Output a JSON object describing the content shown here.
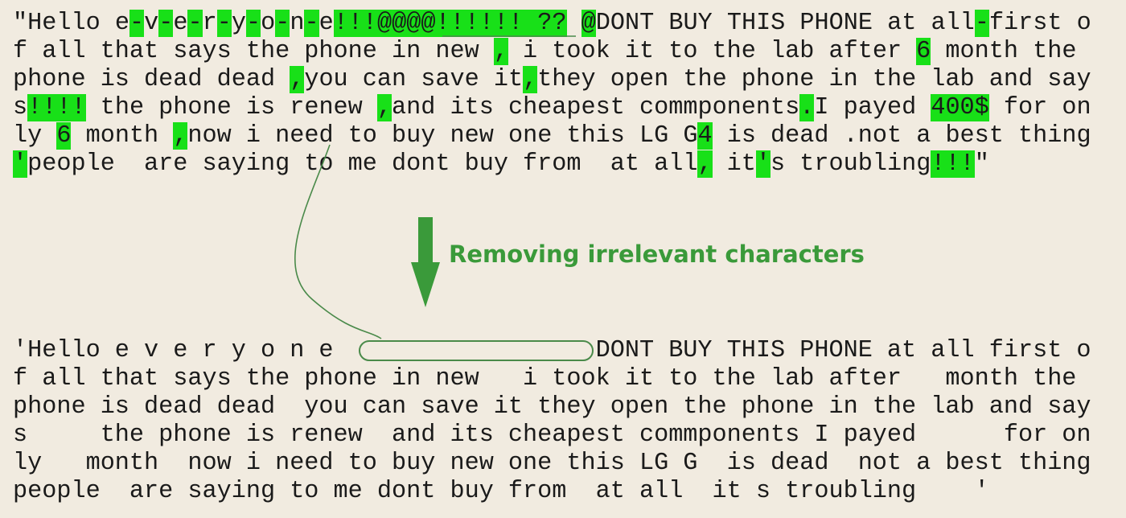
{
  "before_text": [
    [
      [
        "\"Hello ",
        0
      ],
      [
        "e",
        0
      ],
      [
        "-",
        1
      ],
      [
        "v",
        0
      ],
      [
        "-",
        1
      ],
      [
        "e",
        0
      ],
      [
        "-",
        1
      ],
      [
        "r",
        0
      ],
      [
        "-",
        1
      ],
      [
        "y",
        0
      ],
      [
        "-",
        1
      ],
      [
        "o",
        0
      ],
      [
        "-",
        1
      ],
      [
        "n",
        0
      ],
      [
        "-",
        1
      ],
      [
        "e",
        0
      ],
      [
        "!!!@@@@!!!!!! ??",
        1
      ],
      [
        " ",
        0
      ],
      [
        "@",
        1
      ],
      [
        "DONT BUY THIS PHONE at all",
        0
      ],
      [
        "-",
        1
      ],
      [
        "first o",
        0
      ]
    ],
    [
      [
        "f all that says the phone in new ",
        0
      ],
      [
        ",",
        1
      ],
      [
        " i took it to the lab after ",
        0
      ],
      [
        "6",
        1
      ],
      [
        " month the",
        0
      ]
    ],
    [
      [
        "phone is dead dead ",
        0
      ],
      [
        ",",
        1
      ],
      [
        "you can save it",
        0
      ],
      [
        ",",
        1
      ],
      [
        "they open the phone in the lab and say",
        0
      ]
    ],
    [
      [
        "s",
        0
      ],
      [
        "!!!!",
        1
      ],
      [
        " the phone is renew ",
        0
      ],
      [
        ",",
        1
      ],
      [
        "and its cheapest commponents",
        0
      ],
      [
        ".",
        1
      ],
      [
        "I payed ",
        0
      ],
      [
        "400$",
        1
      ],
      [
        " for on",
        0
      ]
    ],
    [
      [
        "ly ",
        0
      ],
      [
        "6",
        1
      ],
      [
        " month ",
        0
      ],
      [
        ",",
        1
      ],
      [
        "now i need to buy new one this LG G",
        0
      ],
      [
        "4",
        1
      ],
      [
        " is dead .not a best thing",
        0
      ]
    ],
    [
      [
        "'",
        1
      ],
      [
        "people  are saying to me dont buy from  at all",
        0
      ],
      [
        ",",
        1
      ],
      [
        " it",
        0
      ],
      [
        "'",
        1
      ],
      [
        "s troubling",
        0
      ],
      [
        "!!!",
        1
      ],
      [
        "\"",
        0
      ]
    ]
  ],
  "caption": "Removing irrelevant characters",
  "after_text": [
    "'Hello e v e r y o n e                  DONT BUY THIS PHONE at all first o",
    "f all that says the phone in new   i took it to the lab after   month the",
    "phone is dead dead  you can save it they open the phone in the lab and say",
    "s     the phone is renew  and its cheapest commponents I payed      for on",
    "ly   month  now i need to buy new one this LG G  is dead  not a best thing",
    "people  are saying to me dont buy from  at all  it s troubling    '"
  ],
  "colors": {
    "highlight": "#18e018",
    "arrow": "#3a9a3a",
    "connector": "#4a8a4a",
    "background": "#f1ebe0",
    "text": "#1a1a1a"
  }
}
